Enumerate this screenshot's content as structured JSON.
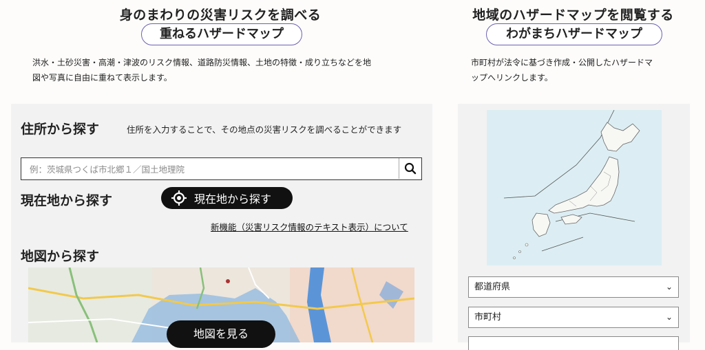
{
  "left": {
    "heading": "身のまわりの災害リスクを調べる",
    "pill": "重ねるハザードマップ",
    "description_line1": "洪水・土砂災害・高潮・津波のリスク情報、道路防災情報、土地の特徴・成り立ちなどを地",
    "description_line2": "図や写真に自由に重ねて表示します。"
  },
  "address_search": {
    "title": "住所から探す",
    "hint": "住所を入力することで、その地点の災害リスクを調べることができます",
    "placeholder": "例：茨城県つくば市北郷１／国土地理院",
    "search_icon": "search-icon"
  },
  "current_location": {
    "title": "現在地から探す",
    "button_label": "現在地から探す",
    "button_icon": "crosshair-icon"
  },
  "new_feature_link": "新機能（災害リスク情報のテキスト表示）について",
  "map_search": {
    "title": "地図から探す",
    "button_label": "地図を見る"
  },
  "right": {
    "heading": "地域のハザードマップを閲覧する",
    "pill": "わがまちハザードマップ",
    "description_line1": "市町村が法令に基づき作成・公開したハザードマ",
    "description_line2": "ップへリンクします。",
    "prefecture_select": "都道府県",
    "municipality_select": "市町村"
  },
  "colors": {
    "accent_border": "#6b5fb0",
    "button_bg": "#111111",
    "panel_bg": "#f2f2f2",
    "map_water": "#dceef3"
  }
}
